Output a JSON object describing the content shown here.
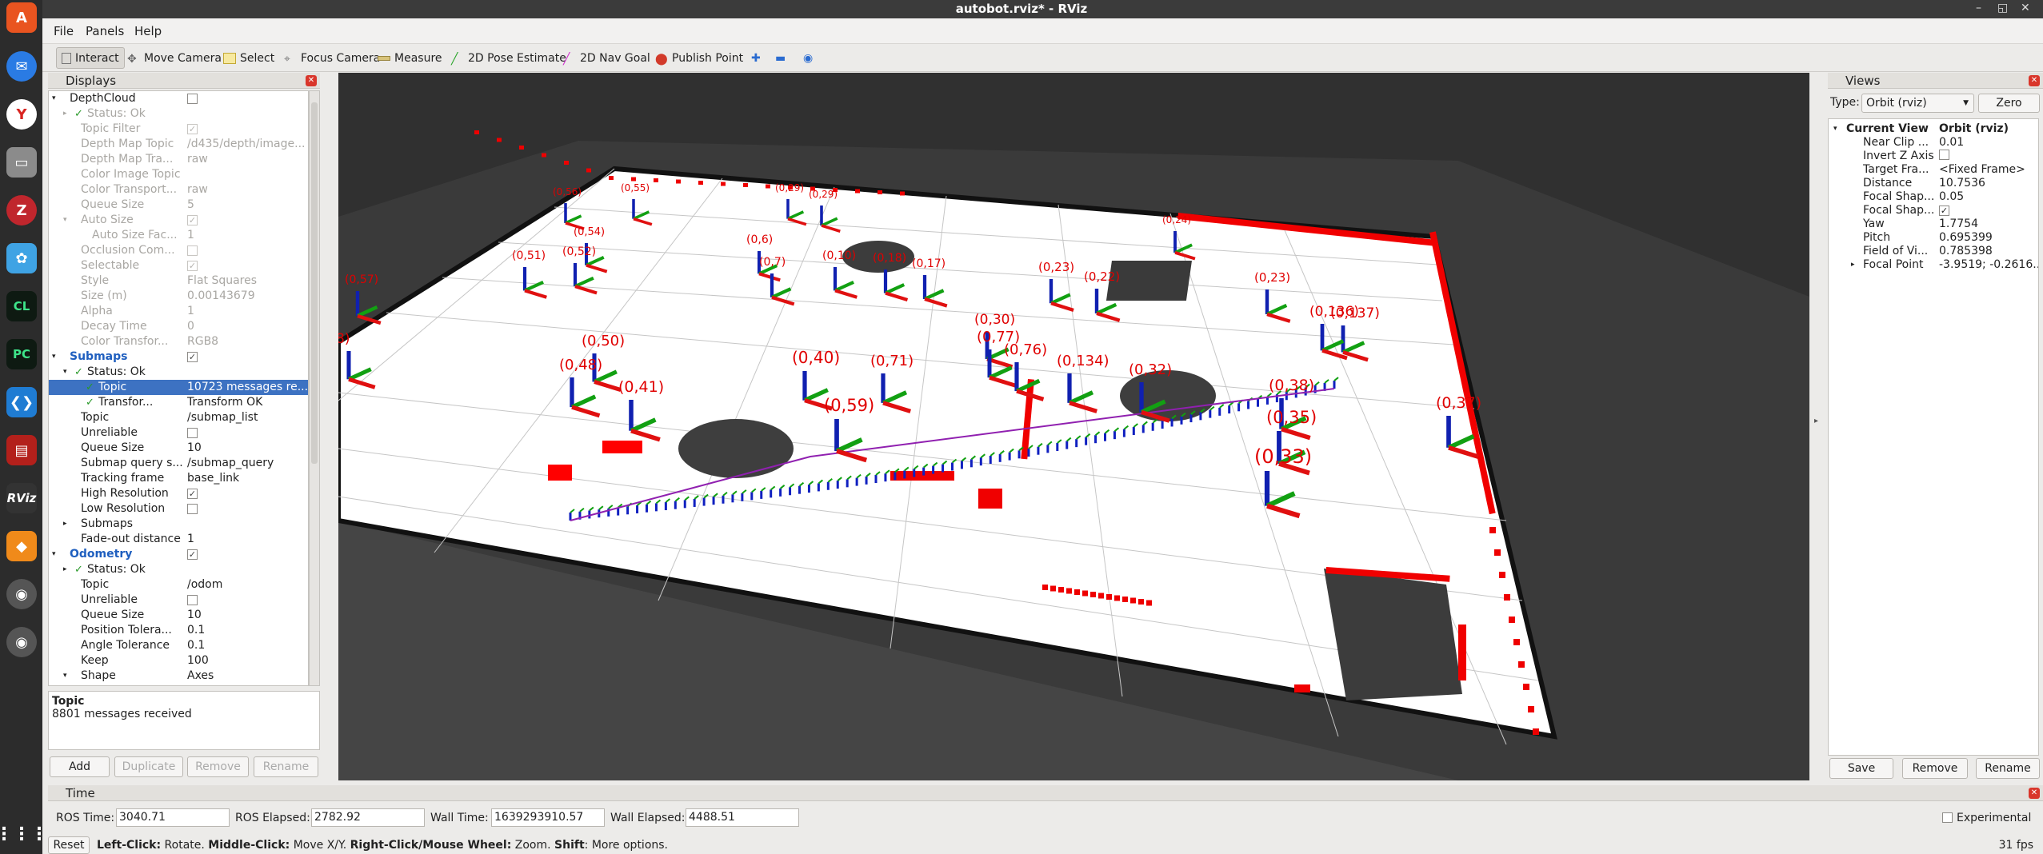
{
  "window": {
    "title": "autobot.rviz* - RViz"
  },
  "menu": {
    "file": "File",
    "panels": "Panels",
    "help": "Help"
  },
  "toolbar": {
    "interact": "Interact",
    "move_camera": "Move Camera",
    "select": "Select",
    "focus_camera": "Focus Camera",
    "measure": "Measure",
    "pose_estimate": "2D Pose Estimate",
    "nav_goal": "2D Nav Goal",
    "publish_point": "Publish Point"
  },
  "displays": {
    "title": "Displays",
    "rows": [
      {
        "k": "DepthCloud",
        "indent": 1,
        "arrow": "▾",
        "cb": "",
        "dim": false,
        "bold": false
      },
      {
        "k": "Status: Ok",
        "indent": 2,
        "arrow": "▸",
        "check": true,
        "dim": true
      },
      {
        "k": "Topic Filter",
        "indent": 2,
        "cb": "✓",
        "dim": true
      },
      {
        "k": "Depth Map Topic",
        "indent": 2,
        "v": "/d435/depth/image...",
        "dim": true
      },
      {
        "k": "Depth Map Tra...",
        "indent": 2,
        "v": "raw",
        "dim": true
      },
      {
        "k": "Color Image Topic",
        "indent": 2,
        "v": "",
        "dim": true
      },
      {
        "k": "Color Transport...",
        "indent": 2,
        "v": "raw",
        "dim": true
      },
      {
        "k": "Queue Size",
        "indent": 2,
        "v": "5",
        "dim": true
      },
      {
        "k": "Auto Size",
        "indent": 2,
        "arrow": "▾",
        "cb": "✓",
        "dim": true
      },
      {
        "k": "Auto Size Fac...",
        "indent": 3,
        "v": "1",
        "dim": true
      },
      {
        "k": "Occlusion Com...",
        "indent": 2,
        "cb": "",
        "dim": true
      },
      {
        "k": "Selectable",
        "indent": 2,
        "cb": "✓",
        "dim": true
      },
      {
        "k": "Style",
        "indent": 2,
        "v": "Flat Squares",
        "dim": true
      },
      {
        "k": "Size (m)",
        "indent": 2,
        "v": "0.00143679",
        "dim": true
      },
      {
        "k": "Alpha",
        "indent": 2,
        "v": "1",
        "dim": true
      },
      {
        "k": "Decay Time",
        "indent": 2,
        "v": "0",
        "dim": true
      },
      {
        "k": "Color Transfor...",
        "indent": 2,
        "v": "RGB8",
        "dim": true
      },
      {
        "k": "Submaps",
        "indent": 1,
        "arrow": "▾",
        "cb": "✓",
        "blue": true
      },
      {
        "k": "Status: Ok",
        "indent": 2,
        "arrow": "▾",
        "check": true
      },
      {
        "k": "Topic",
        "indent": 3,
        "check": true,
        "v": "10723 messages re...",
        "sel": true
      },
      {
        "k": "Transfor...",
        "indent": 3,
        "check": true,
        "v": "Transform OK"
      },
      {
        "k": "Topic",
        "indent": 2,
        "v": "/submap_list"
      },
      {
        "k": "Unreliable",
        "indent": 2,
        "cb": ""
      },
      {
        "k": "Queue Size",
        "indent": 2,
        "v": "10"
      },
      {
        "k": "Submap query s...",
        "indent": 2,
        "v": "/submap_query"
      },
      {
        "k": "Tracking frame",
        "indent": 2,
        "v": "base_link"
      },
      {
        "k": "High Resolution",
        "indent": 2,
        "cb": "✓"
      },
      {
        "k": "Low Resolution",
        "indent": 2,
        "cb": ""
      },
      {
        "k": "Submaps",
        "indent": 2,
        "arrow": "▸"
      },
      {
        "k": "Fade-out distance",
        "indent": 2,
        "v": "1"
      },
      {
        "k": "Odometry",
        "indent": 1,
        "arrow": "▾",
        "cb": "✓",
        "blue": true
      },
      {
        "k": "Status: Ok",
        "indent": 2,
        "arrow": "▸",
        "check": true
      },
      {
        "k": "Topic",
        "indent": 2,
        "v": "/odom"
      },
      {
        "k": "Unreliable",
        "indent": 2,
        "cb": ""
      },
      {
        "k": "Queue Size",
        "indent": 2,
        "v": "10"
      },
      {
        "k": "Position Tolera...",
        "indent": 2,
        "v": "0.1"
      },
      {
        "k": "Angle Tolerance",
        "indent": 2,
        "v": "0.1"
      },
      {
        "k": "Keep",
        "indent": 2,
        "v": "100"
      },
      {
        "k": "Shape",
        "indent": 2,
        "arrow": "▾",
        "v": "Axes"
      }
    ],
    "desc_title": "Topic",
    "desc_text": "8801 messages received",
    "add": "Add",
    "duplicate": "Duplicate",
    "remove": "Remove",
    "rename": "Rename"
  },
  "views": {
    "title": "Views",
    "type_label": "Type:",
    "type_value": "Orbit (rviz)",
    "zero": "Zero",
    "current_view": "Current View",
    "current_view_value": "Orbit (rviz)",
    "rows": [
      {
        "k": "Near Clip ...",
        "v": "0.01"
      },
      {
        "k": "Invert Z Axis",
        "cb": ""
      },
      {
        "k": "Target Fra...",
        "v": "<Fixed Frame>"
      },
      {
        "k": "Distance",
        "v": "10.7536"
      },
      {
        "k": "Focal Shap...",
        "v": "0.05"
      },
      {
        "k": "Focal Shap...",
        "cb": "✓"
      },
      {
        "k": "Yaw",
        "v": "1.7754"
      },
      {
        "k": "Pitch",
        "v": "0.695399"
      },
      {
        "k": "Field of Vi...",
        "v": "0.785398"
      },
      {
        "k": "Focal Point",
        "v": "-3.9519; -0.2616...",
        "arrow": "▸"
      }
    ],
    "save": "Save",
    "remove": "Remove",
    "rename": "Rename"
  },
  "time": {
    "title": "Time",
    "ros_time_label": "ROS Time:",
    "ros_time": "3040.71",
    "ros_elapsed_label": "ROS Elapsed:",
    "ros_elapsed": "2782.92",
    "wall_time_label": "Wall Time:",
    "wall_time": "1639293910.57",
    "wall_elapsed_label": "Wall Elapsed:",
    "wall_elapsed": "4488.51",
    "experimental": "Experimental"
  },
  "status": {
    "reset": "Reset",
    "left_click": "Left-Click:",
    "left_text": " Rotate. ",
    "middle_click": "Middle-Click:",
    "middle_text": " Move X/Y. ",
    "right_click": "Right-Click/Mouse Wheel:",
    "right_text": " Zoom. ",
    "shift": "Shift",
    "shift_text": ": More options.",
    "fps": "31 fps"
  },
  "scene_labels": [
    {
      "t": "(0,56)",
      "s": 12
    },
    {
      "t": "(0,55)",
      "s": 12
    },
    {
      "t": "(0,29)",
      "s": 12
    },
    {
      "t": "(0,29)",
      "s": 12
    },
    {
      "t": "(0,24)",
      "s": 12
    },
    {
      "t": "(0,54)",
      "s": 13
    },
    {
      "t": "(0,51)",
      "s": 14
    },
    {
      "t": "(0,52)",
      "s": 14
    },
    {
      "t": "(0,6)",
      "s": 14
    },
    {
      "t": "(0,7)",
      "s": 14
    },
    {
      "t": "(0,10)",
      "s": 14
    },
    {
      "t": "(0,18)",
      "s": 14
    },
    {
      "t": "(0,17)",
      "s": 14
    },
    {
      "t": "(0,23)",
      "s": 15
    },
    {
      "t": "(0,22)",
      "s": 15
    },
    {
      "t": "(0,23)",
      "s": 15
    },
    {
      "t": "(0,57)",
      "s": 14
    },
    {
      "t": "(0,30)",
      "s": 17
    },
    {
      "t": "(0,137)",
      "s": 17
    },
    {
      "t": "(0,136)",
      "s": 17
    },
    {
      "t": "8)",
      "s": 17
    },
    {
      "t": "(0,50)",
      "s": 18
    },
    {
      "t": "(0,40)",
      "s": 20
    },
    {
      "t": "(0,77)",
      "s": 18
    },
    {
      "t": "(0,76)",
      "s": 18
    },
    {
      "t": "(0,134)",
      "s": 18
    },
    {
      "t": "(0,32)",
      "s": 18
    },
    {
      "t": "(0,48)",
      "s": 18
    },
    {
      "t": "(0,71)",
      "s": 18
    },
    {
      "t": "(0,41)",
      "s": 19
    },
    {
      "t": "(0,59)",
      "s": 21
    },
    {
      "t": "(0,38)",
      "s": 19
    },
    {
      "t": "(0,35)",
      "s": 21
    },
    {
      "t": "(0,37)",
      "s": 19
    },
    {
      "t": "(0,33)",
      "s": 24
    }
  ]
}
